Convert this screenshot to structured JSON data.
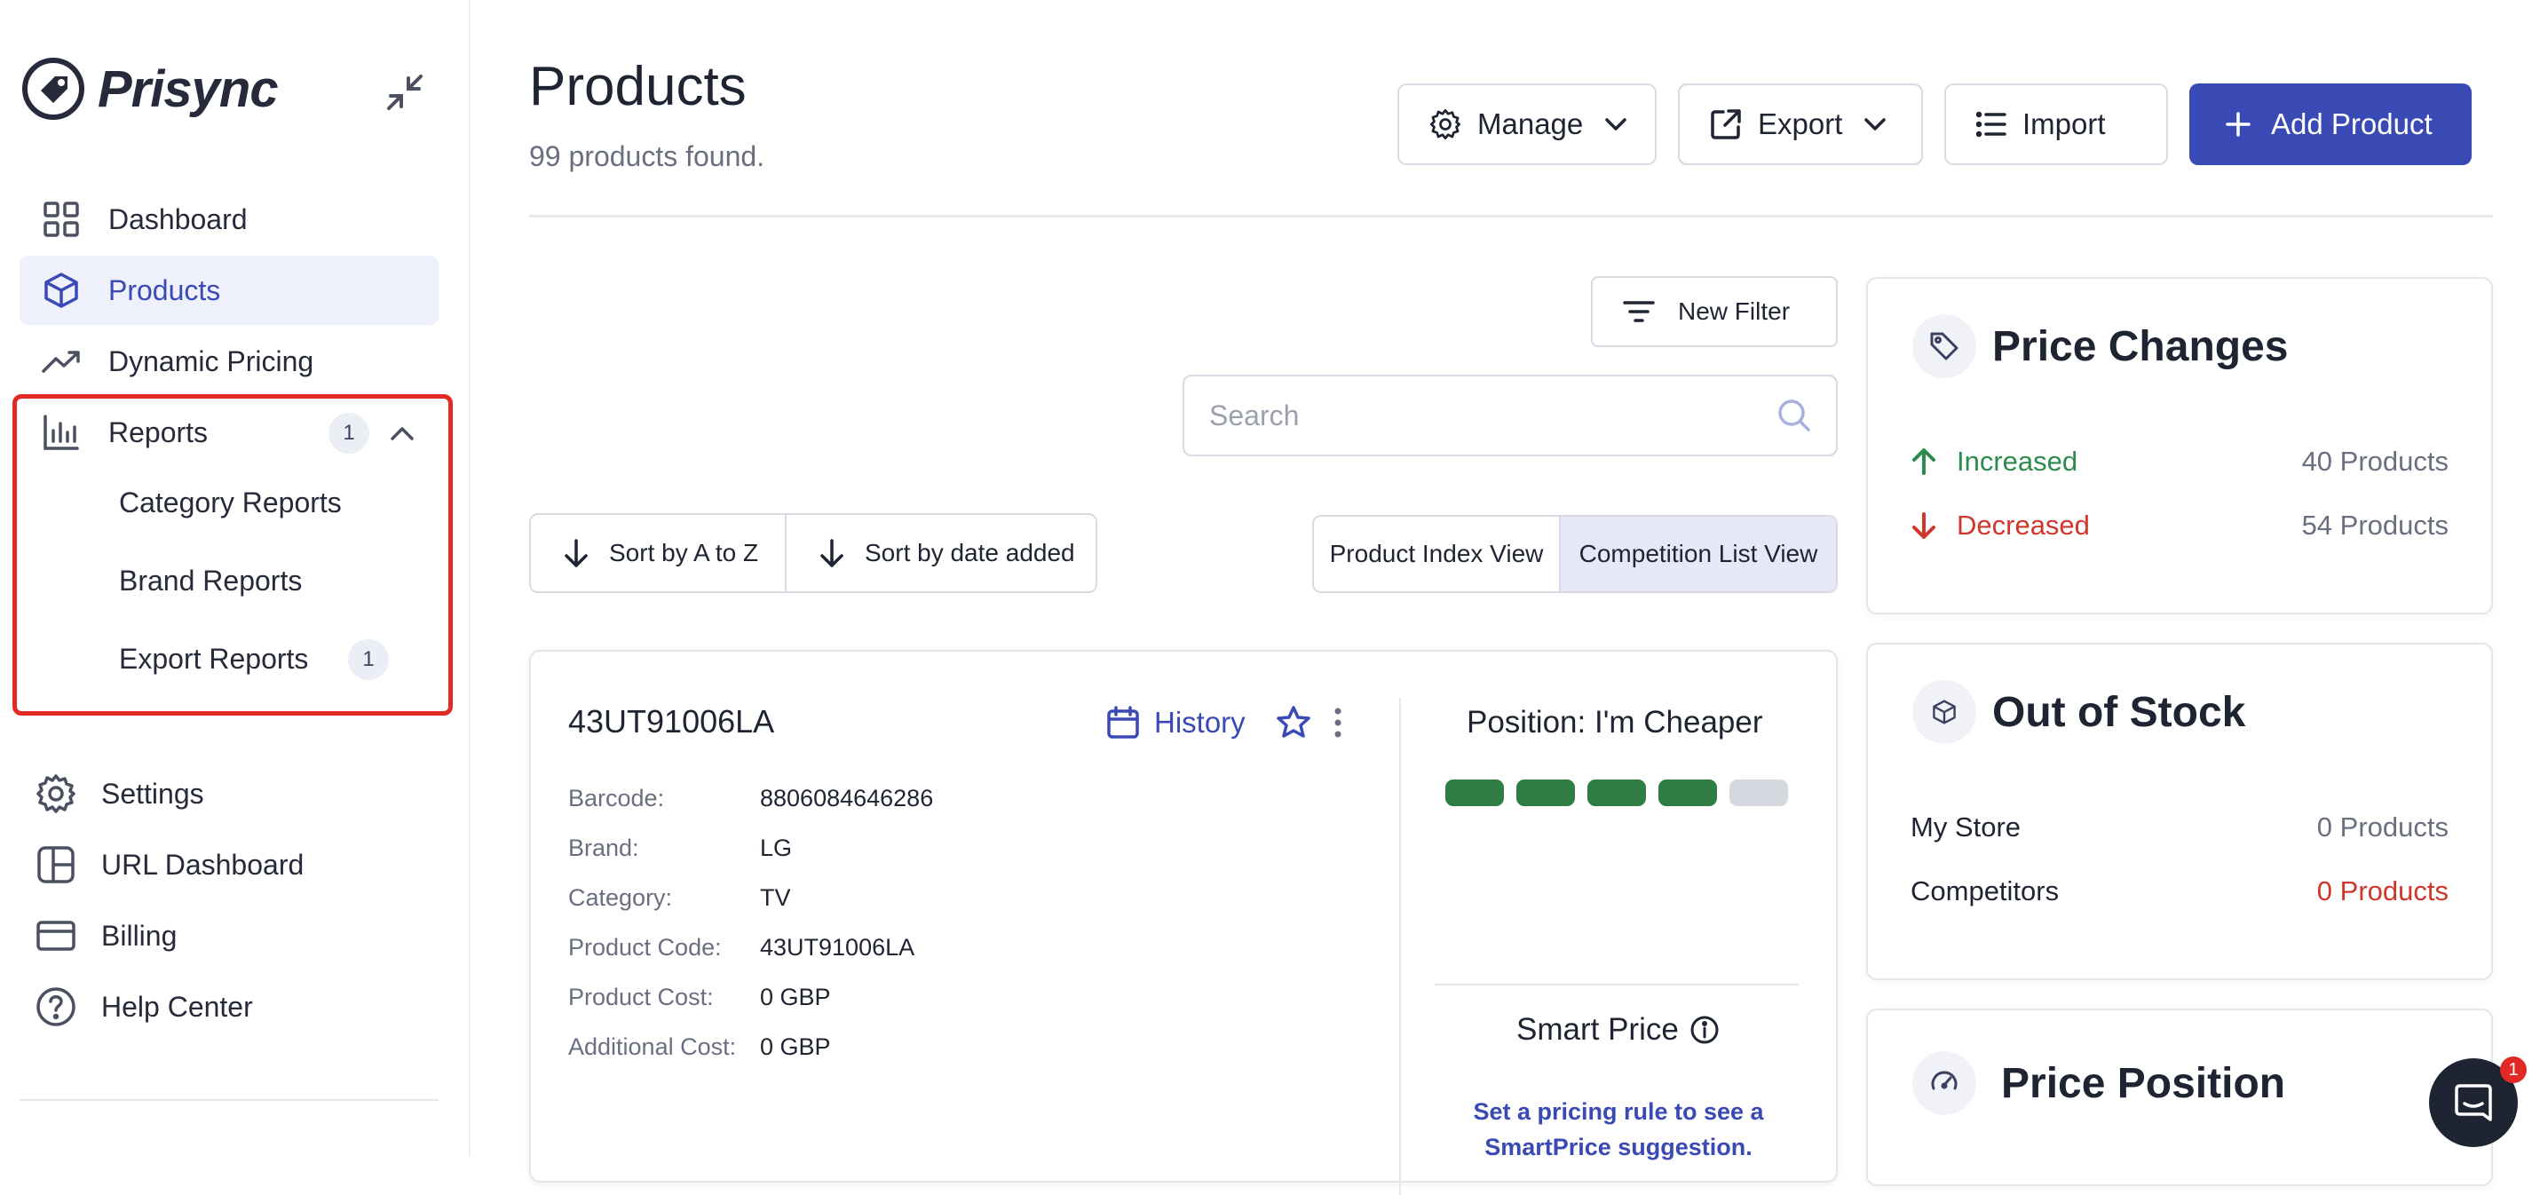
{
  "brand": {
    "name": "Prisync"
  },
  "sidebar": {
    "items": [
      {
        "label": "Dashboard",
        "icon": "grid-icon"
      },
      {
        "label": "Products",
        "icon": "cube-icon",
        "active": true
      },
      {
        "label": "Dynamic Pricing",
        "icon": "trending-up-icon"
      },
      {
        "label": "Reports",
        "icon": "bar-chart-icon",
        "badge": "1"
      }
    ],
    "reports_sub": [
      {
        "label": "Category Reports"
      },
      {
        "label": "Brand Reports"
      },
      {
        "label": "Export Reports",
        "badge": "1"
      }
    ],
    "bottom": [
      {
        "label": "Settings",
        "icon": "gear-icon"
      },
      {
        "label": "URL Dashboard",
        "icon": "layout-icon"
      },
      {
        "label": "Billing",
        "icon": "credit-card-icon"
      },
      {
        "label": "Help Center",
        "icon": "help-circle-icon"
      }
    ]
  },
  "header": {
    "title": "Products",
    "count": "99 products found.",
    "manage": "Manage",
    "export": "Export",
    "import": "Import",
    "add": "Add Product"
  },
  "filters": {
    "new_filter": "New Filter",
    "search_placeholder": "Search",
    "sort_az": "Sort by A to Z",
    "sort_date": "Sort by date added",
    "view_index": "Product Index View",
    "view_competition": "Competition List View"
  },
  "product": {
    "sku": "43UT91006LA",
    "history": "History",
    "fields": [
      {
        "k": "Barcode:",
        "v": "8806084646286"
      },
      {
        "k": "Brand:",
        "v": "LG"
      },
      {
        "k": "Category:",
        "v": "TV"
      },
      {
        "k": "Product Code:",
        "v": "43UT91006LA"
      },
      {
        "k": "Product Cost:",
        "v": "0 GBP"
      },
      {
        "k": "Additional Cost:",
        "v": "0 GBP"
      }
    ],
    "position": "Position: I'm Cheaper",
    "position_level": 4,
    "position_max": 5,
    "smart_price": "Smart Price",
    "smart_desc": "Set a pricing rule to see a SmartPrice suggestion."
  },
  "price_changes": {
    "title": "Price Changes",
    "increased_label": "Increased",
    "increased_value": "40 Products",
    "decreased_label": "Decreased",
    "decreased_value": "54 Products"
  },
  "out_of_stock": {
    "title": "Out of Stock",
    "my_store_label": "My Store",
    "my_store_value": "0 Products",
    "competitors_label": "Competitors",
    "competitors_value": "0 Products"
  },
  "price_position": {
    "title": "Price Position"
  },
  "chat": {
    "badge": "1"
  },
  "colors": {
    "primary": "#3a4ab5",
    "increase": "#2e8b4f",
    "decrease": "#d0372c",
    "pip_on": "#2f7d45",
    "pip_off": "#d5d8df",
    "highlight": "#e02a23"
  }
}
